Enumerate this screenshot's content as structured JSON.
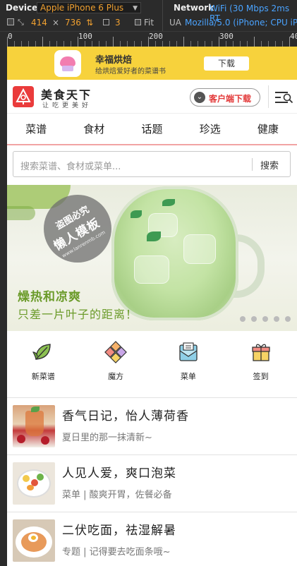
{
  "devtools": {
    "device_label": "Device",
    "device_value": "Apple iPhone 6 Plus",
    "width": "414",
    "times": "×",
    "height": "736",
    "dpr": "3",
    "fit_label": "Fit",
    "network_label": "Network",
    "network_value": "WiFi (30 Mbps 2ms RT",
    "ua_label": "UA",
    "ua_value": "Mozilla/5.0 (iPhone; CPU iPho",
    "ruler_ticks": [
      "0",
      "100",
      "200",
      "300",
      "400"
    ]
  },
  "app_banner": {
    "name": "幸福烘焙",
    "desc": "给烘焙爱好者的菜谱书",
    "download": "下载"
  },
  "header": {
    "site_name": "美食天下",
    "slogan": "让吃更美好",
    "client_download": "客户端下载"
  },
  "nav": {
    "tabs": [
      "菜谱",
      "食材",
      "话题",
      "珍选",
      "健康"
    ]
  },
  "search": {
    "placeholder": "搜索菜谱、食材或菜单...",
    "button": "搜索"
  },
  "banner": {
    "stamp_line1": "盗图必究",
    "stamp_line2": "懒人模板",
    "stamp_line3": "www.lanrenmb.com",
    "line1": "燥热和凉爽",
    "line2": "只差一片叶子的距离！",
    "dot_count": 5
  },
  "quick_links": [
    {
      "label": "新菜谱",
      "icon": "leaf-icon"
    },
    {
      "label": "魔方",
      "icon": "cube-icon"
    },
    {
      "label": "菜单",
      "icon": "menu-envelope-icon"
    },
    {
      "label": "签到",
      "icon": "gift-icon"
    }
  ],
  "feed": [
    {
      "title": "香气日记，怡人薄荷香",
      "sub": "夏日里的那一抹清新~"
    },
    {
      "title": "人见人爱，爽口泡菜",
      "sub": "菜单 | 酸爽开胃，佐餐必备"
    },
    {
      "title": "二伏吃面，祛湿解暑",
      "sub": "专题 | 记得要去吃面条哦~"
    }
  ],
  "colors": {
    "brand_red": "#ea3b3b",
    "banner_yellow": "#f7d23c",
    "slogan_green": "#6b9b2a"
  }
}
